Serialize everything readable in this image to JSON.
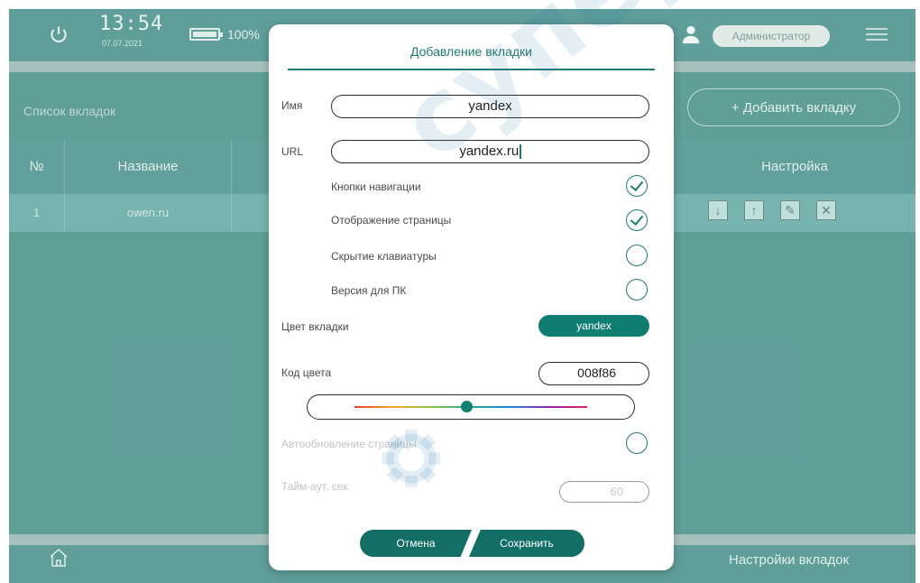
{
  "status": {
    "time": "13:54",
    "date": "07.07.2021",
    "battery": "100%",
    "user_role": "Администратор"
  },
  "page": {
    "list_title": "Список вкладок",
    "add_button": "+ Добавить вкладку",
    "bottom_label": "Настройки вкладок"
  },
  "table": {
    "headers": [
      "№",
      "Название",
      "Настройка"
    ],
    "rows": [
      {
        "num": "1",
        "name": "owen.ru"
      }
    ]
  },
  "dialog": {
    "title": "Добавление вкладки",
    "name_label": "Имя",
    "name_value": "yandex",
    "url_label": "URL",
    "url_value": "yandex.ru",
    "options": [
      {
        "label": "Кнопки навигации",
        "checked": true
      },
      {
        "label": "Отображение страницы",
        "checked": true
      },
      {
        "label": "Скрытие клавиатуры",
        "checked": false
      },
      {
        "label": "Версия для ПК",
        "checked": false
      }
    ],
    "color_label": "Цвет вкладки",
    "color_chip": "yandex",
    "code_label": "Код цвета",
    "code_value": "008f86",
    "auto_label": "Автообновление страницы",
    "timeout_label": "Тайм-аут, сек",
    "timeout_value": "60",
    "cancel": "Отмена",
    "save": "Сохранить"
  },
  "watermark": "суперайс",
  "colors": {
    "accent": "#0f7d72",
    "background": "#0c6a62"
  }
}
